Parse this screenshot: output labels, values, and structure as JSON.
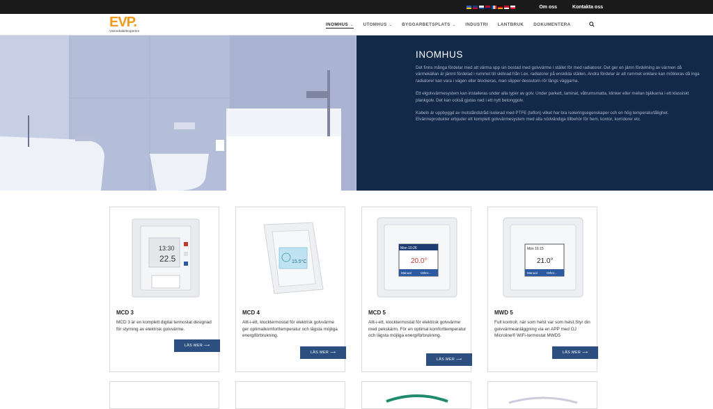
{
  "topbar": {
    "flags": [
      "se-flag",
      "gb-flag",
      "fi-flag",
      "no-flag",
      "fr-flag",
      "de-flag",
      "dk-flag",
      "pl-flag"
    ],
    "links": [
      "Om oss",
      "Kontakta oss"
    ]
  },
  "logo": {
    "mark": "EVP.",
    "tagline": "Värmekabelexperten"
  },
  "nav": {
    "items": [
      {
        "label": "INOMHUS",
        "dropdown": true,
        "active": true
      },
      {
        "label": "UTOMHUS",
        "dropdown": true
      },
      {
        "label": "BYGGARBETSPLATS",
        "dropdown": true
      },
      {
        "label": "INDUSTRI"
      },
      {
        "label": "LANTBRUK"
      },
      {
        "label": "DOKUMENTERA"
      }
    ]
  },
  "hero": {
    "title": "INOMHUS",
    "paragraphs": [
      "Det finns många fördelar med att värma upp sin bostad med golvvärme i stället för med radiatorer. Det ger en jämn fördelning av värmen då värmekällan är jämnt fördelad i rummet till skillnad från t.ex. radiatorer på enskilda ställen. Andra fördelar är att rummet enklare kan möbleras då inga radiatorer kan vara i vägen eller blockeras, man slipper dessutom rör längs väggarna.",
      "Ett elgolvvärmesystem kan installeras under alla typer av golv. Under parkett, laminat, våtrumsmatta, klinker eller mellan bjälkarna i ett klassiskt plankgolv. Det kan också gjutas ned i ett nytt betonggolv.",
      "Kabeln är uppbyggd av motståndstråd isolerad med PTFE (teflon) vilket har bra isoleringsegenskaper och en hög temperaturtålighet. Elvärmeprodukter erbjuder ett komplett golvvärmesystem med alla nödvändiga tillbehör för hem, kontor, korridorer etc."
    ]
  },
  "cards": [
    {
      "title": "MCD 3",
      "desc": "MCD 3 är en komplett digital termostat designad för styrning av elektrisk golvvärme.",
      "button": "LÄS MER ⟶",
      "screen_time": "13:30",
      "screen_temp": "22.5"
    },
    {
      "title": "MCD 4",
      "desc": "Allt-i-ett, klocktermostat för elektrisk golvvärme ger optimalkomforttemperatur och lägsta möjliga energiförbrukning.",
      "button": "LÄS MER ⟶",
      "screen_temp": "15.5°C"
    },
    {
      "title": "MCD 5",
      "desc": "Allt-i-ett, klocktermostat för elektrisk golvvärme med pekskärm. För en optimal komforttemperatur och lägsta möjliga energiförbrukning.",
      "button": "LÄS MER ⟶",
      "screen_time": "Mon 10:26",
      "screen_temp": "20.0°",
      "screen_btn1": "Manual",
      "screen_btn2": "Other..."
    },
    {
      "title": "MWD 5",
      "desc": "Full kontroll, när som helst var som helst.Styr din golvvärmeanläggning via en APP med OJ Microline® WiFi-termostat MWD5",
      "button": "LÄS MER ⟶",
      "screen_time": "Mon 16:15",
      "screen_temp": "21.0°",
      "screen_btn1": "Manual",
      "screen_btn2": "Other..."
    }
  ],
  "colors": {
    "accent": "#f29a1f",
    "hero_panel": "#13294a",
    "button": "#2c4f7f"
  }
}
